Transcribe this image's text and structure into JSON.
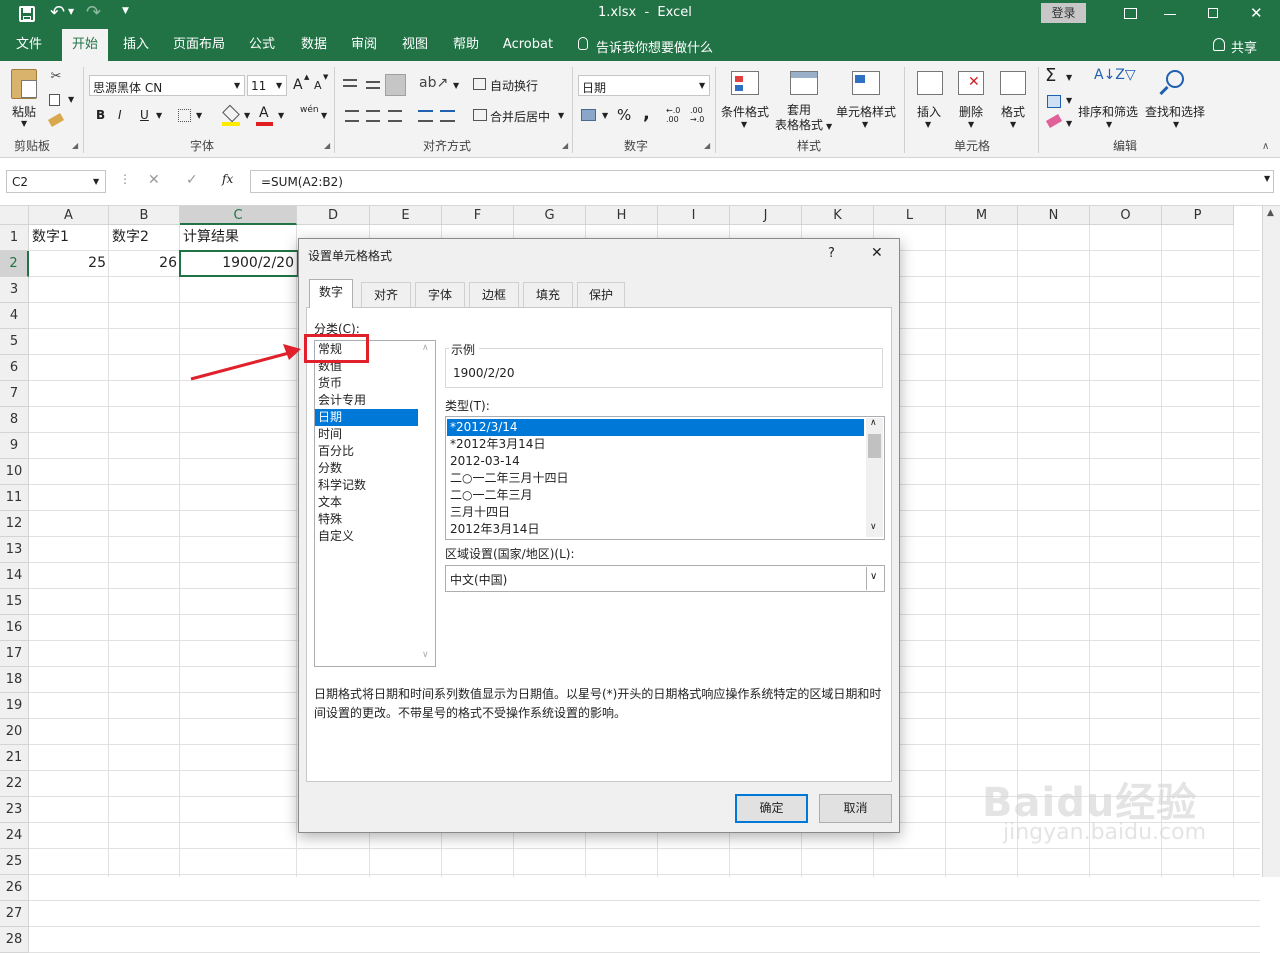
{
  "title": {
    "filename": "1.xlsx",
    "sep": "-",
    "app": "Excel",
    "login": "登录",
    "undo": "↶",
    "redo": "↷"
  },
  "tabs": [
    "文件",
    "开始",
    "插入",
    "页面布局",
    "公式",
    "数据",
    "审阅",
    "视图",
    "帮助",
    "Acrobat"
  ],
  "tell_me": "告诉我你想要做什么",
  "share": "共享",
  "ribbon": {
    "clipboard": {
      "paste": "粘贴",
      "label": "剪贴板"
    },
    "font": {
      "name": "思源黑体 CN",
      "size": "11",
      "bold": "B",
      "italic": "I",
      "underline": "U",
      "grow": "A",
      "shrink": "A",
      "label": "字体",
      "wen": "wén",
      "color_letter": "A"
    },
    "align": {
      "wrap": "自动换行",
      "merge": "合并后居中",
      "label": "对齐方式"
    },
    "number": {
      "format": "日期",
      "label": "数字",
      "percent": "%",
      "comma": ",",
      "inc": "←.0\n.00",
      "dec": ".00\n→.0"
    },
    "styles": {
      "cond": "条件格式",
      "table": "套用\n表格格式",
      "cell": "单元格样式",
      "label": "样式"
    },
    "cells": {
      "insert": "插入",
      "delete": "删除",
      "format": "格式",
      "label": "单元格"
    },
    "editing": {
      "sort": "排序和筛选",
      "find": "查找和选择",
      "label": "编辑"
    }
  },
  "formula_bar": {
    "name_box": "C2",
    "fx": "fx",
    "formula": "=SUM(A2:B2)",
    "cancel": "✕",
    "enter": "✓"
  },
  "columns": [
    "A",
    "B",
    "C",
    "D",
    "E",
    "F",
    "G",
    "H",
    "I",
    "J",
    "K",
    "L",
    "M",
    "N",
    "O",
    "P"
  ],
  "rows": [
    "1",
    "2",
    "3",
    "4",
    "5",
    "6",
    "7",
    "8",
    "9",
    "10",
    "11",
    "12",
    "13",
    "14",
    "15",
    "16",
    "17",
    "18",
    "19",
    "20",
    "21",
    "22",
    "23",
    "24",
    "25",
    "26",
    "27",
    "28"
  ],
  "cells": {
    "A1": "数字1",
    "B1": "数字2",
    "C1": "计算结果",
    "A2": "25",
    "B2": "26",
    "C2": "1900/2/20"
  },
  "dialog": {
    "title": "设置单元格格式",
    "help": "?",
    "close": "✕",
    "tabs": [
      "数字",
      "对齐",
      "字体",
      "边框",
      "填充",
      "保护"
    ],
    "category_label": "分类(C):",
    "categories": [
      "常规",
      "数值",
      "货币",
      "会计专用",
      "日期",
      "时间",
      "百分比",
      "分数",
      "科学记数",
      "文本",
      "特殊",
      "自定义"
    ],
    "selected_category": "日期",
    "sample_label": "示例",
    "sample_value": "1900/2/20",
    "type_label": "类型(T):",
    "types": [
      "*2012/3/14",
      "*2012年3月14日",
      "2012-03-14",
      "二○一二年三月十四日",
      "二○一二年三月",
      "三月十四日",
      "2012年3月14日"
    ],
    "locale_label": "区域设置(国家/地区)(L):",
    "locale_value": "中文(中国)",
    "description": "日期格式将日期和时间系列数值显示为日期值。以星号(*)开头的日期格式响应操作系统特定的区域日期和时间设置的更改。不带星号的格式不受操作系统设置的影响。",
    "ok": "确定",
    "cancel": "取消"
  },
  "colors": {
    "excel_green": "#217346",
    "selection_blue": "#0078d7",
    "highlight_red": "#e0202a"
  },
  "watermark": {
    "brand": "Baidu经验",
    "url": "jingyan.baidu.com"
  }
}
